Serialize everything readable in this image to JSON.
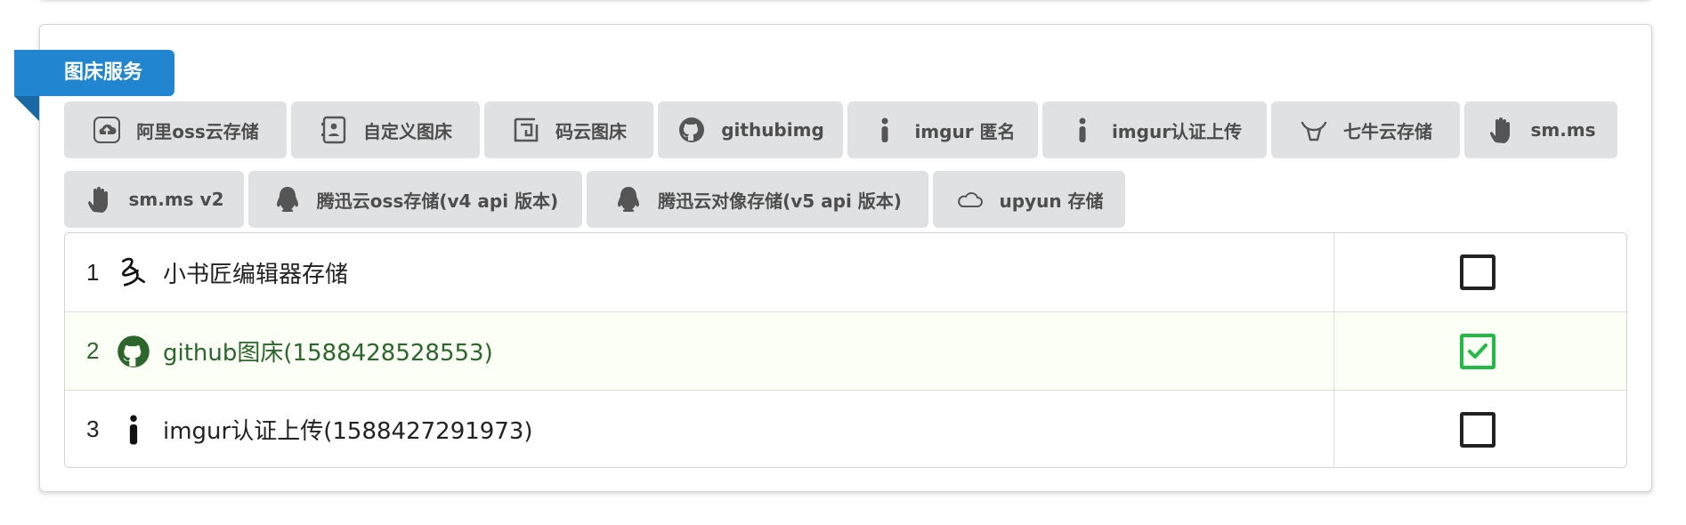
{
  "section": {
    "title": "图床服务"
  },
  "tabs": [
    {
      "label": "阿里oss云存储",
      "icon": "aliyun-cloud-icon"
    },
    {
      "label": "自定义图床",
      "icon": "address-card-icon"
    },
    {
      "label": "码云图床",
      "icon": "gitee-icon"
    },
    {
      "label": "githubimg",
      "icon": "github-icon"
    },
    {
      "label": "imgur 匿名",
      "icon": "info-icon"
    },
    {
      "label": "imgur认证上传",
      "icon": "info-icon"
    },
    {
      "label": "七牛云存储",
      "icon": "qiniu-icon"
    },
    {
      "label": "sm.ms",
      "icon": "hand-icon"
    },
    {
      "label": "sm.ms v2",
      "icon": "hand-icon"
    },
    {
      "label": "腾迅云oss存储(v4 api 版本)",
      "icon": "qq-penguin-icon"
    },
    {
      "label": "腾迅云对像存储(v5 api 版本)",
      "icon": "qq-penguin-icon"
    },
    {
      "label": "upyun 存储",
      "icon": "cloud-icon"
    }
  ],
  "rows": [
    {
      "index": "1",
      "name": "小书匠编辑器存储",
      "icon": "xiaoshujiang-icon",
      "selected": false
    },
    {
      "index": "2",
      "name": "github图床(1588428528553)",
      "icon": "github-icon",
      "selected": true
    },
    {
      "index": "3",
      "name": "imgur认证上传(1588427291973)",
      "icon": "info-icon",
      "selected": false
    }
  ],
  "colors": {
    "ribbon": "#2185d0",
    "positive_text": "#2c662d",
    "checkbox_on": "#21ba45"
  }
}
